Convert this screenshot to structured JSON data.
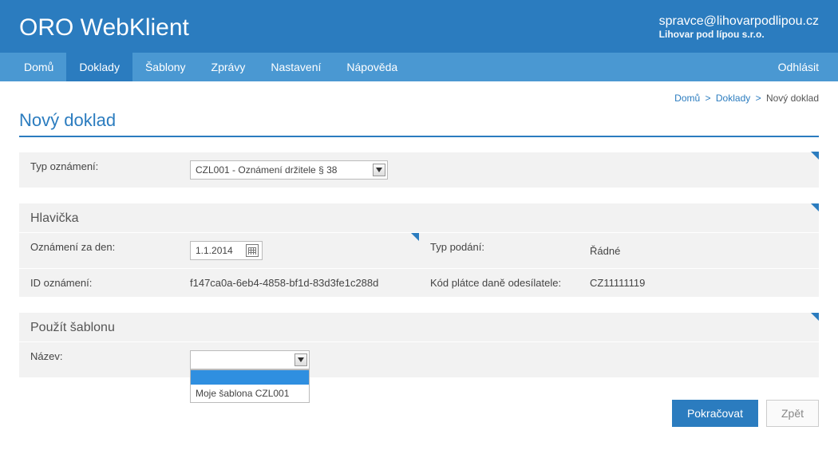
{
  "header": {
    "app_title": "ORO WebKlient",
    "user_email": "spravce@lihovarpodlipou.cz",
    "user_company": "Lihovar pod lípou s.r.o."
  },
  "nav": {
    "items": [
      {
        "label": "Domů",
        "active": false
      },
      {
        "label": "Doklady",
        "active": true
      },
      {
        "label": "Šablony",
        "active": false
      },
      {
        "label": "Zprávy",
        "active": false
      },
      {
        "label": "Nastavení",
        "active": false
      },
      {
        "label": "Nápověda",
        "active": false
      }
    ],
    "logout": "Odhlásit"
  },
  "breadcrumb": {
    "items": [
      "Domů",
      "Doklady"
    ],
    "current": "Nový doklad",
    "sep": ">"
  },
  "page": {
    "title": "Nový doklad"
  },
  "form": {
    "typ_oznameni": {
      "label": "Typ oznámení:",
      "selected": "CZL001 - Oznámení držitele § 38"
    },
    "hlavicka_title": "Hlavička",
    "oznameni_za_den": {
      "label": "Oznámení za den:",
      "value": "1.1.2014"
    },
    "typ_podani": {
      "label": "Typ podání:",
      "value": "Řádné"
    },
    "id_oznameni": {
      "label": "ID oznámení:",
      "value": "f147ca0a-6eb4-4858-bf1d-83d3fe1c288d"
    },
    "kod_platce": {
      "label": "Kód plátce daně odesílatele:",
      "value": "CZ11111119"
    },
    "sablona_title": "Použít šablonu",
    "nazev": {
      "label": "Název:",
      "selected": "",
      "options": [
        "",
        "Moje šablona CZL001"
      ]
    }
  },
  "buttons": {
    "continue": "Pokračovat",
    "back": "Zpět"
  }
}
